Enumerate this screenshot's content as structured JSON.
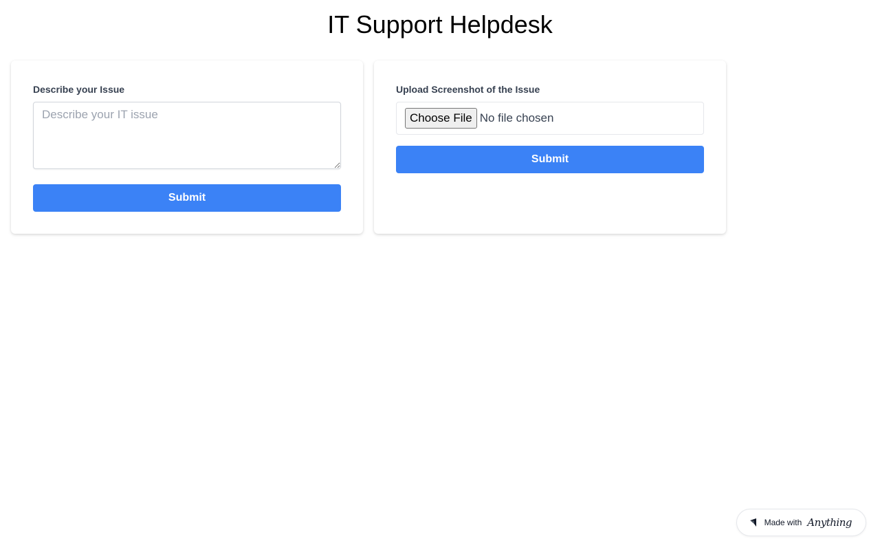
{
  "header": {
    "title": "IT Support Helpdesk"
  },
  "describe_card": {
    "label": "Describe your Issue",
    "textarea_placeholder": "Describe your IT issue",
    "textarea_value": "",
    "submit_label": "Submit"
  },
  "upload_card": {
    "label": "Upload Screenshot of the Issue",
    "choose_file_label": "Choose File",
    "file_status": "No file chosen",
    "submit_label": "Submit"
  },
  "badge": {
    "made_with": "Made with",
    "brand": "Anything",
    "logo_icon": "anything-logo-icon"
  },
  "colors": {
    "primary": "#3b82f6",
    "label": "#374151",
    "placeholder": "#9ca3af"
  }
}
